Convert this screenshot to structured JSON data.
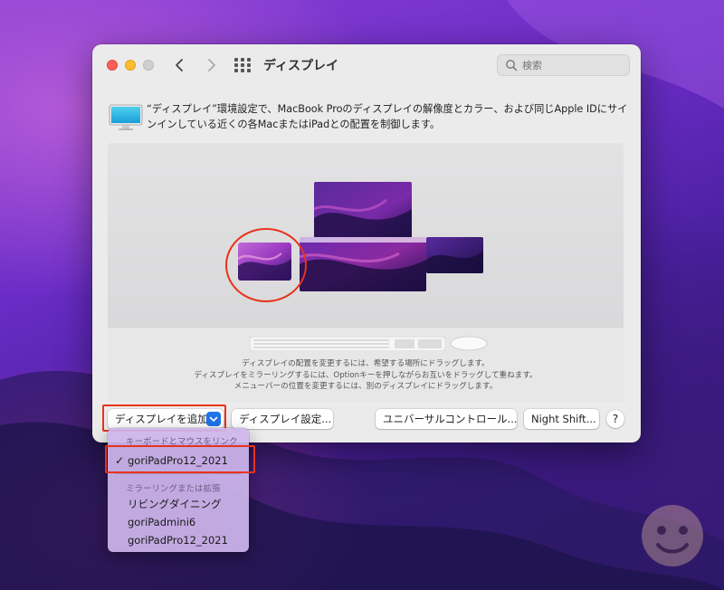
{
  "window": {
    "title": "ディスプレイ",
    "search_placeholder": "検索"
  },
  "description": "“ディスプレイ”環境設定で、MacBook Proのディスプレイの解像度とカラー、および同じApple IDにサインインしている近くの各MacまたはiPadとの配置を制御します。",
  "arrangement": {
    "help_lines": [
      "ディスプレイの配置を変更するには、希望する場所にドラッグします。",
      "ディスプレイをミラーリングするには、Optionキーを押しながらお互いをドラッグして重ねます。",
      "メニューバーの位置を変更するには、別のディスプレイにドラッグします。"
    ]
  },
  "buttons": {
    "add_display": "ディスプレイを追加",
    "display_settings": "ディスプレイ設定...",
    "universal_control": "ユニバーサルコントロール...",
    "night_shift": "Night Shift...",
    "help": "?"
  },
  "dropdown": {
    "section1_header": "キーボードとマウスをリンク",
    "section1_items": [
      "goriPadPro12_2021"
    ],
    "checked_mark": "✓",
    "section2_header": "ミラーリングまたは拡張",
    "section2_items": [
      "リビングダイニング",
      "goriPadmini6",
      "goriPadPro12_2021"
    ]
  },
  "colors": {
    "accent": "#1e74e8",
    "annotation_red": "#e8331c",
    "close": "#fe5f57",
    "minimize": "#febc2e"
  }
}
